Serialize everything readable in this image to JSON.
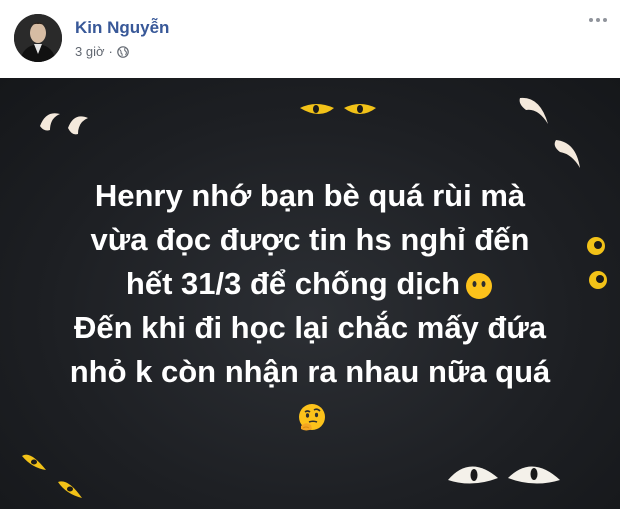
{
  "post": {
    "author": "Kin Nguyễn",
    "time": "3 giờ",
    "separator": "·",
    "privacy_icon": "globe-icon",
    "menu_icon": "more-options-icon",
    "text_lines": [
      "Henry nhớ bạn bè quá rùi mà",
      "vừa đọc được tin hs nghỉ đến",
      "hết 31/3 để chống dịch",
      "Đến khi đi học lại chắc mấy đứa",
      "nhỏ k còn nhận ra nhau nữa quá"
    ],
    "emoji_line3": "face-without-mouth-emoji",
    "emoji_end": "thinking-face-emoji",
    "background_color": "#1d1f23",
    "text_color": "#ffffff",
    "author_color": "#385898"
  }
}
